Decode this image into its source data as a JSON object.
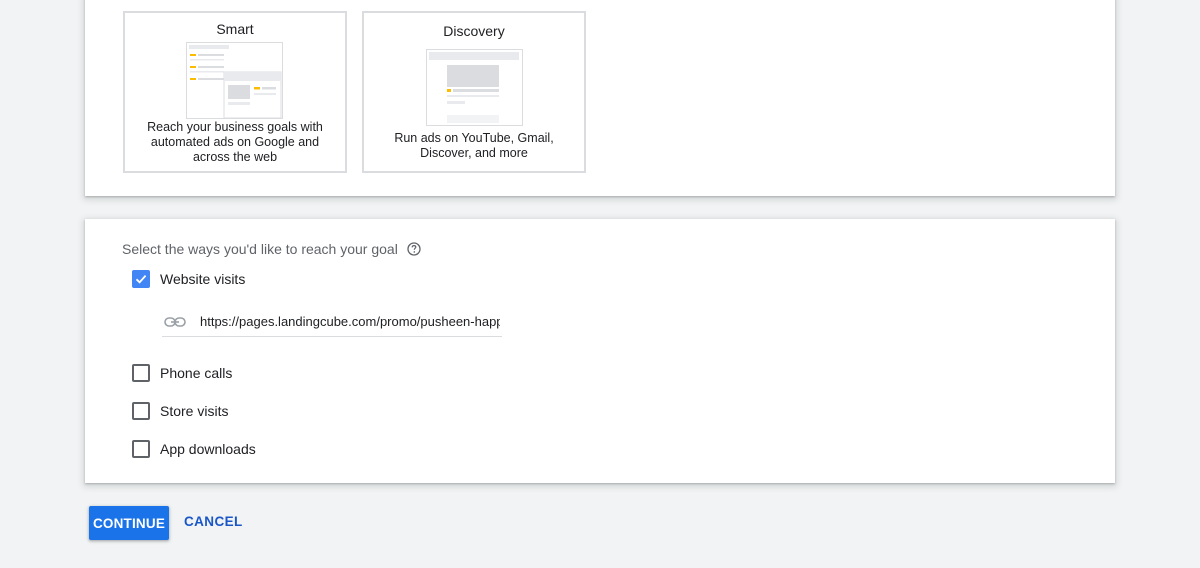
{
  "campaign_types": [
    {
      "title": "Smart",
      "description": "Reach your business goals with automated ads on Google and across the web"
    },
    {
      "title": "Discovery",
      "description": "Run ads on YouTube, Gmail, Discover, and more"
    }
  ],
  "goals": {
    "prompt": "Select the ways you'd like to reach your goal",
    "help_icon": "help-circle-icon",
    "options": [
      {
        "label": "Website visits",
        "checked": true
      },
      {
        "label": "Phone calls",
        "checked": false
      },
      {
        "label": "Store visits",
        "checked": false
      },
      {
        "label": "App downloads",
        "checked": false
      }
    ],
    "website_url": {
      "value": "https://pages.landingcube.com/promo/pusheen-happy-",
      "icon": "link-icon"
    }
  },
  "actions": {
    "continue_label": "CONTINUE",
    "cancel_label": "CANCEL"
  },
  "colors": {
    "accent": "#1a73e8",
    "checkbox_checked": "#4285f4",
    "background": "#f1f3f4"
  }
}
